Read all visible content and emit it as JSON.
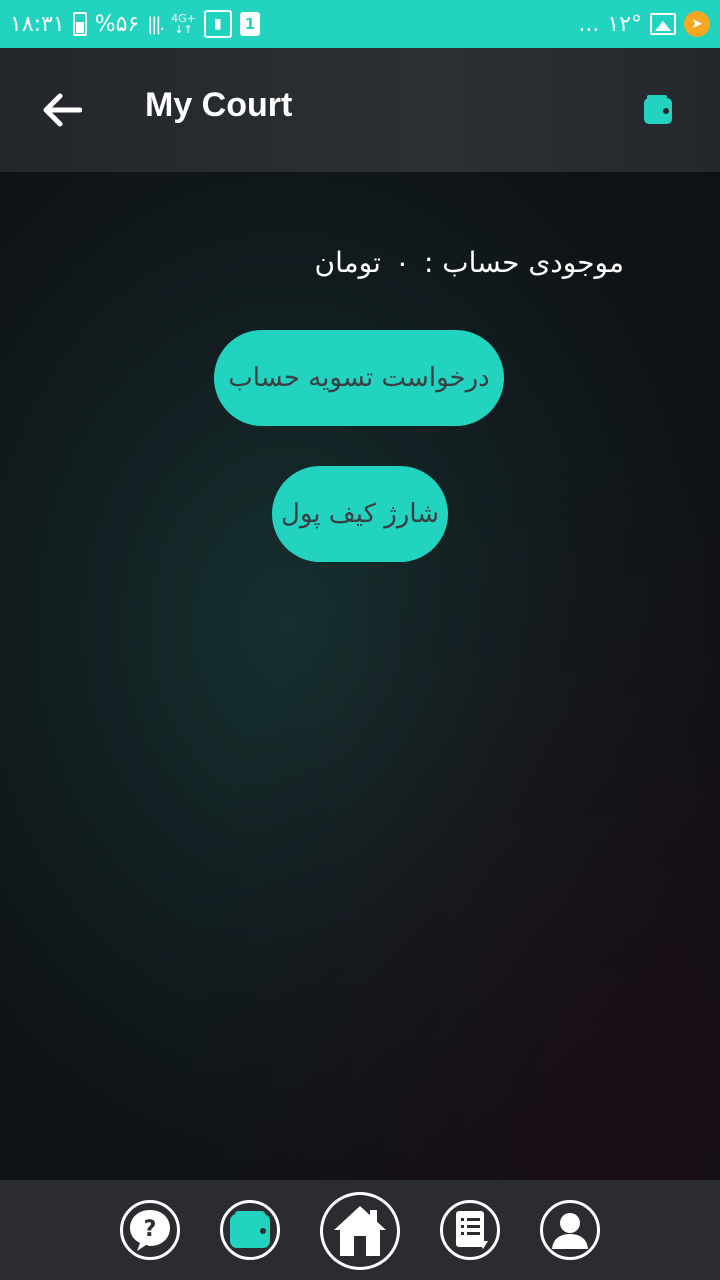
{
  "status_bar": {
    "time": "۱۸:۳۱",
    "battery": "%۵۶",
    "signal": "|||.",
    "network": "4G+",
    "network_arrows": "↓↑",
    "sim": "1",
    "temperature": "۱۲°",
    "more": "...",
    "icons": [
      "battery-icon",
      "signal-icon",
      "network-4g-icon",
      "signal-box-icon",
      "sim-1-icon",
      "gallery-icon",
      "telegram-icon"
    ]
  },
  "app_bar": {
    "title": "My Court",
    "back_icon": "arrow-left-icon",
    "wallet_icon": "wallet-icon"
  },
  "main": {
    "balance_label": "موجودی حساب :",
    "balance_value": "۰",
    "currency": "تومان",
    "settle_button": "درخواست تسویه حساب",
    "charge_button": "شارژ کیف پول"
  },
  "bottom_nav": {
    "items": [
      "help-icon",
      "wallet-icon",
      "home-icon",
      "list-icon",
      "profile-icon"
    ],
    "active": "home-icon",
    "accent": "#22d3c0"
  },
  "colors": {
    "accent": "#22d3c0",
    "app_bar": "#2b3034",
    "background": "#0f1417",
    "nav": "#2a2c30"
  }
}
